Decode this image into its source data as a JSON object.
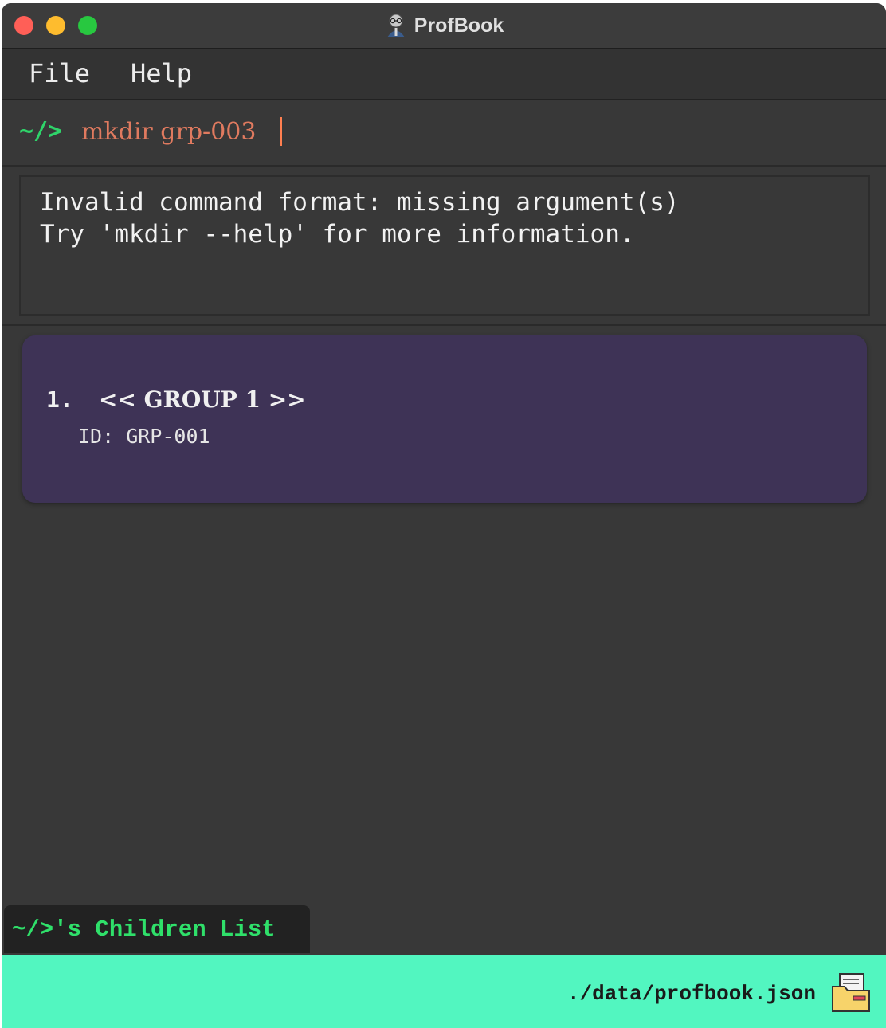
{
  "window": {
    "title": "ProfBook"
  },
  "menu": {
    "items": [
      {
        "label": "File"
      },
      {
        "label": "Help"
      }
    ]
  },
  "command": {
    "prompt": "~/>",
    "value": "mkdir grp-003"
  },
  "result": {
    "lines": [
      "Invalid command format: missing argument(s)",
      "Try 'mkdir --help' for more information."
    ]
  },
  "list": {
    "items": [
      {
        "index": "1.",
        "name": "<< GROUP 1 >>",
        "id_label": "ID: GRP-001"
      }
    ]
  },
  "children_tab": {
    "label": "~/>'s Children List"
  },
  "status": {
    "path": "./data/profbook.json",
    "icon": "folder-icon"
  },
  "colors": {
    "prompt_green": "#2fd46a",
    "command_text": "#e07a5f",
    "card_bg": "#3e3356",
    "status_bg": "#52f6c0",
    "window_bg": "#383838"
  }
}
